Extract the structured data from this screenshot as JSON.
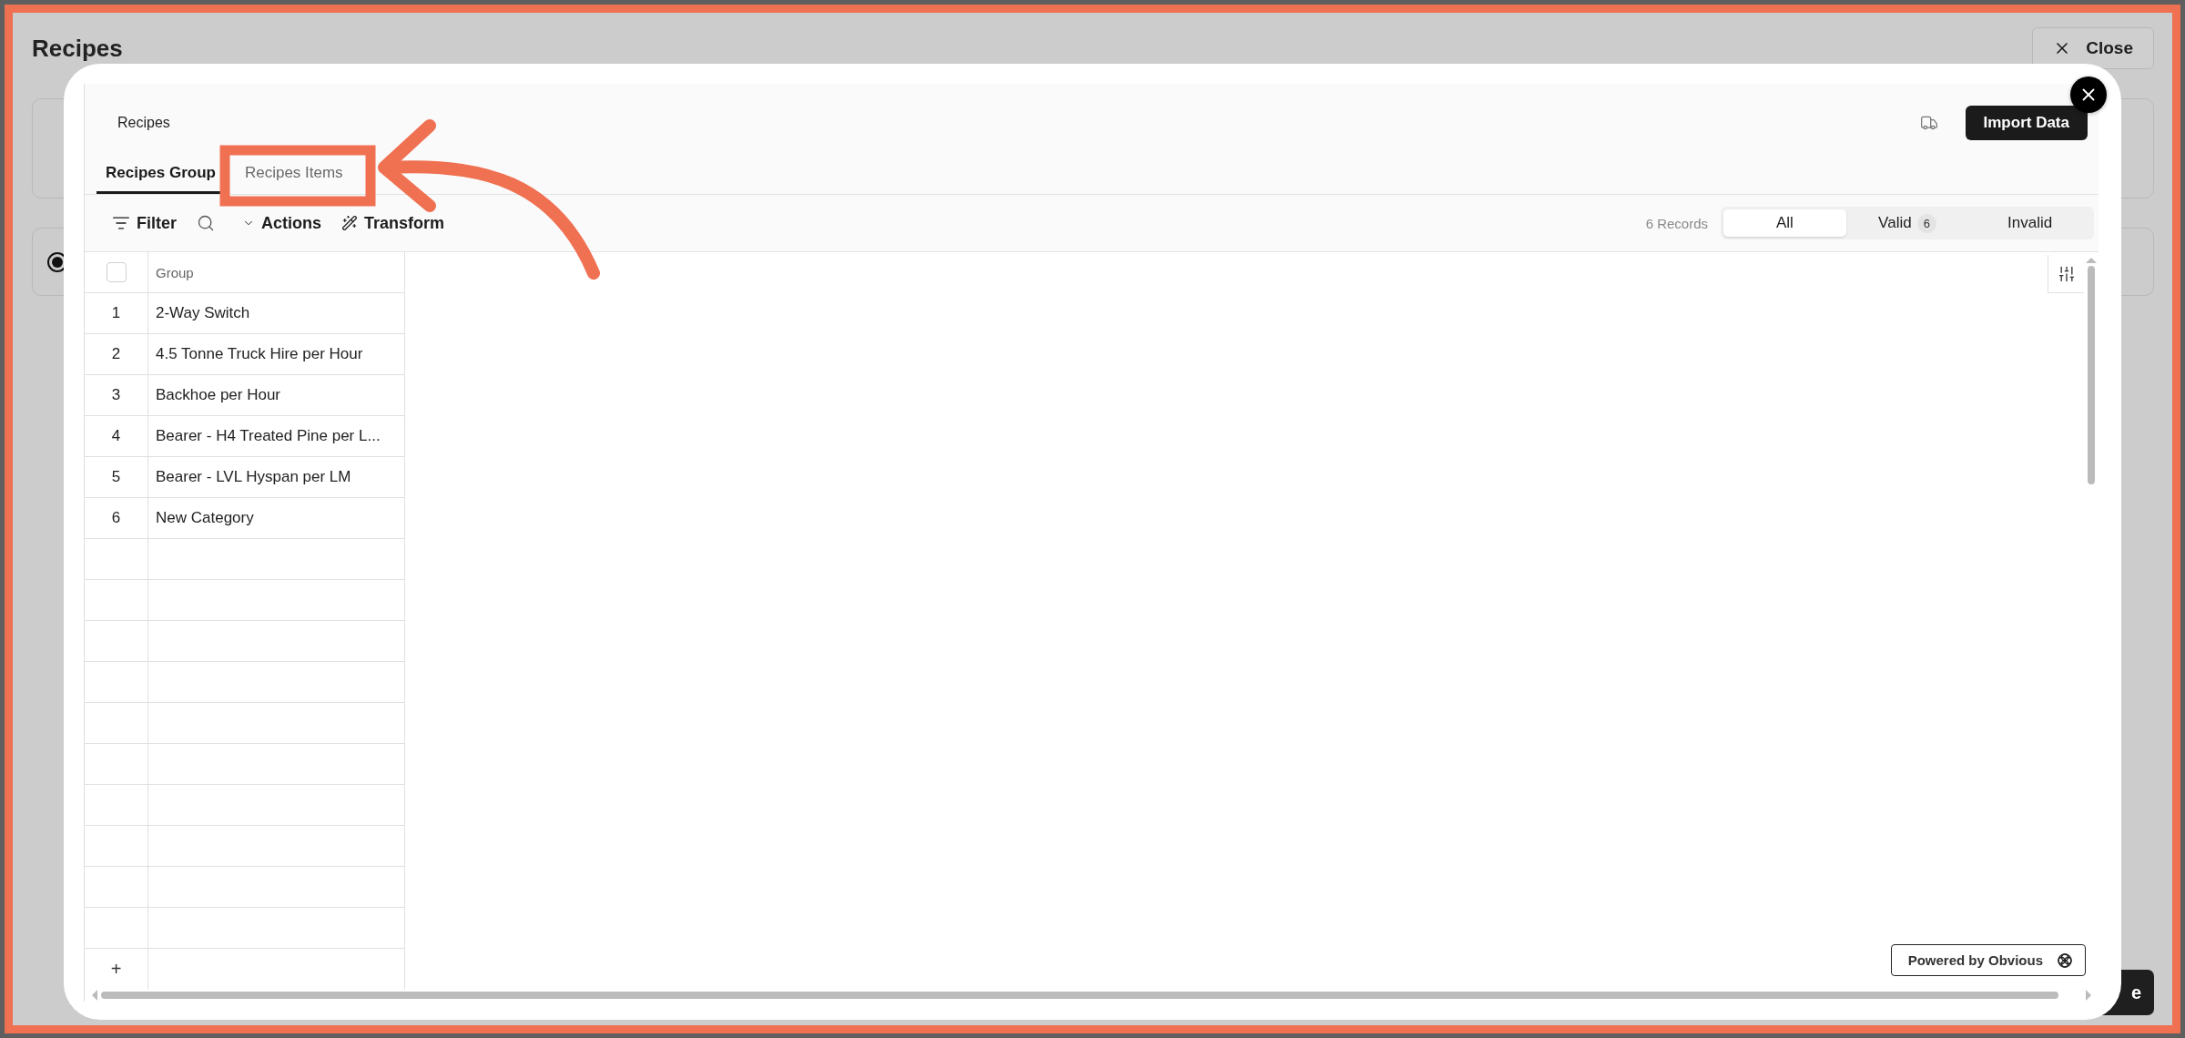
{
  "page": {
    "title": "Recipes",
    "close_button": "Close",
    "radio_selected": true,
    "covered_button": "e"
  },
  "modal": {
    "title": "Recipes",
    "import_button": "Import Data",
    "tabs": [
      {
        "label": "Recipes Group",
        "selected": true
      },
      {
        "label": "Recipes Items",
        "selected": false
      }
    ],
    "toolbar": {
      "filter": "Filter",
      "actions": "Actions",
      "transform": "Transform"
    },
    "records": "6 Records",
    "segments": [
      {
        "label": "All",
        "selected": true
      },
      {
        "label": "Valid",
        "count": "6",
        "selected": false
      },
      {
        "label": "Invalid",
        "selected": false
      }
    ],
    "table": {
      "select_all_checked": false,
      "columns": [
        "Group"
      ],
      "rows": [
        {
          "index": "1",
          "group": "2-Way Switch"
        },
        {
          "index": "2",
          "group": "4.5 Tonne Truck Hire per Hour"
        },
        {
          "index": "3",
          "group": "Backhoe per Hour"
        },
        {
          "index": "4",
          "group": "Bearer - H4 Treated Pine per L..."
        },
        {
          "index": "5",
          "group": "Bearer - LVL Hyspan per LM"
        },
        {
          "index": "6",
          "group": "New Category"
        }
      ],
      "add_row": "+"
    },
    "powered_by": "Powered by Obvious"
  }
}
